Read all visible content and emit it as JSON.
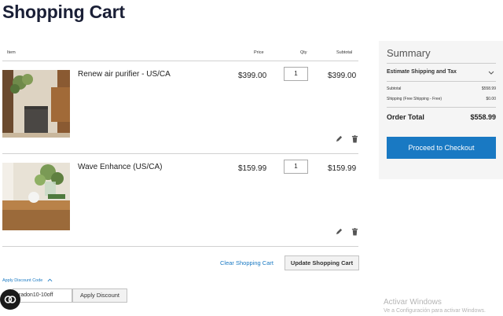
{
  "page": {
    "title": "Shopping Cart"
  },
  "cart": {
    "headers": {
      "item": "Item",
      "price": "Price",
      "qty": "Qty",
      "subtotal": "Subtotal"
    },
    "items": [
      {
        "name": "Renew air purifier - US/CA",
        "price": "$399.00",
        "qty": "1",
        "subtotal": "$399.00",
        "image": "air-purifier-photo"
      },
      {
        "name": "Wave Enhance (US/CA)",
        "price": "$159.99",
        "qty": "1",
        "subtotal": "$159.99",
        "image": "speaker-on-shelf-photo"
      }
    ],
    "clear_label": "Clear Shopping Cart",
    "update_label": "Update Shopping Cart"
  },
  "discount": {
    "toggle_label": "Apply Discount Code",
    "code_value": "radon10-10off",
    "apply_label": "Apply Discount"
  },
  "summary": {
    "title": "Summary",
    "estimate_label": "Estimate Shipping and Tax",
    "subtotal_label": "Subtotal",
    "subtotal_value": "$558.99",
    "shipping_label": "Shipping (Free Shipping - Free)",
    "shipping_value": "$0.00",
    "total_label": "Order Total",
    "total_value": "$558.99",
    "checkout_label": "Proceed to Checkout"
  },
  "watermark": {
    "line1": "Activar Windows",
    "line2": "Ve a Configuración para activar Windows."
  },
  "colors": {
    "accent": "#1979c3",
    "title": "#1a1f36",
    "summary_bg": "#f5f5f5"
  },
  "icons": {
    "edit": "pencil-icon",
    "delete": "trash-icon",
    "chat": "chat-bubble-icon",
    "chevron": "chevron-down-icon"
  }
}
